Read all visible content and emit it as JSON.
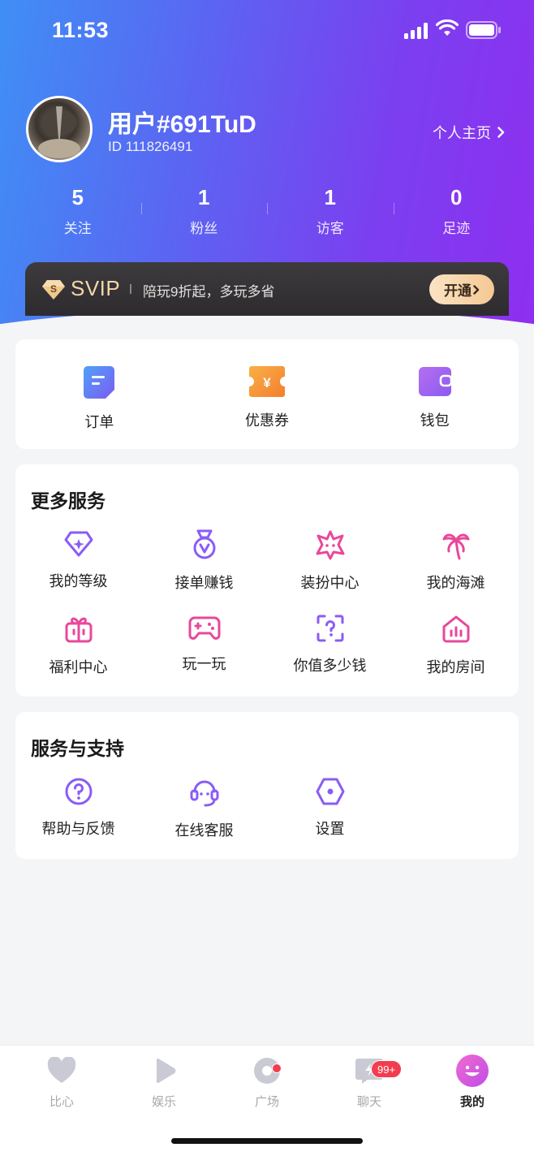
{
  "status_bar": {
    "time": "11:53"
  },
  "profile": {
    "name": "用户#691TuD",
    "id": "ID 111826491",
    "home_link": "个人主页"
  },
  "stats": [
    {
      "value": "5",
      "label": "关注"
    },
    {
      "value": "1",
      "label": "粉丝"
    },
    {
      "value": "1",
      "label": "访客"
    },
    {
      "value": "0",
      "label": "足迹"
    }
  ],
  "svip": {
    "title": "SVIP",
    "desc": "陪玩9折起，多玩多省",
    "button": "开通"
  },
  "quick_actions": [
    {
      "label": "订单",
      "icon": "order-icon"
    },
    {
      "label": "优惠券",
      "icon": "coupon-icon"
    },
    {
      "label": "钱包",
      "icon": "wallet-icon"
    }
  ],
  "more_services": {
    "title": "更多服务",
    "items": [
      {
        "label": "我的等级",
        "icon": "level-gem-icon"
      },
      {
        "label": "接单赚钱",
        "icon": "medal-icon"
      },
      {
        "label": "装扮中心",
        "icon": "dress-up-star-icon"
      },
      {
        "label": "我的海滩",
        "icon": "palm-tree-icon"
      },
      {
        "label": "福利中心",
        "icon": "gift-icon"
      },
      {
        "label": "玩一玩",
        "icon": "gamepad-icon"
      },
      {
        "label": "你值多少钱",
        "icon": "question-frame-icon"
      },
      {
        "label": "我的房间",
        "icon": "room-house-icon"
      }
    ]
  },
  "support": {
    "title": "服务与支持",
    "items": [
      {
        "label": "帮助与反馈",
        "icon": "help-icon"
      },
      {
        "label": "在线客服",
        "icon": "headset-icon"
      },
      {
        "label": "设置",
        "icon": "settings-hex-icon"
      }
    ]
  },
  "tabbar": [
    {
      "label": "比心",
      "icon": "heart-icon"
    },
    {
      "label": "娱乐",
      "icon": "play-icon"
    },
    {
      "label": "广场",
      "icon": "disc-icon"
    },
    {
      "label": "聊天",
      "icon": "chat-icon",
      "badge": "99+"
    },
    {
      "label": "我的",
      "icon": "smile-face-icon"
    }
  ],
  "colors": {
    "purple": "#8a5cf6",
    "pink": "#e8489a",
    "accent_gradient_start": "#3f8ff5",
    "accent_gradient_end": "#8e2fef"
  }
}
